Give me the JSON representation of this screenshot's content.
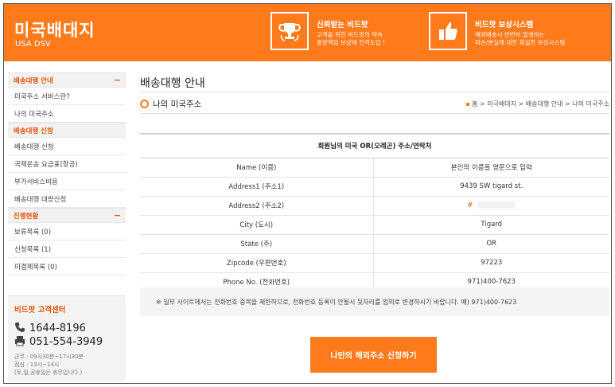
{
  "header": {
    "logo_title": "미국배대지",
    "logo_sub": "USA DSV",
    "promos": [
      {
        "icon": "trophy-icon",
        "title": "신뢰받는 비드팟",
        "lines": [
          "고객을 위한 비드팟의 약속",
          "중량책임 보상제 전격도입 !"
        ]
      },
      {
        "icon": "thumbs-up-icon",
        "title": "비드팟 보상시스템",
        "lines": [
          "해외배송시 빈번히 발생하는",
          "파손/분실에 대한 확실한 보상시스템"
        ]
      }
    ]
  },
  "sidebar": {
    "sections": [
      {
        "title": "배송대행 안내",
        "toggle": "−",
        "items": [
          "미국주소 서비스란?",
          "나의 미국주소"
        ]
      },
      {
        "title": "배송대행 신청",
        "toggle": "",
        "items": [
          "배송대행 신청",
          "국제운송 요금표(항공)",
          "부가서비스비용",
          "배송대행 대량신청"
        ]
      },
      {
        "title": "진행현황",
        "toggle": "−",
        "items": [
          "보류목록 (0)",
          "신청목록 (1)",
          "미결제목록 (0)"
        ]
      }
    ],
    "customer_center": {
      "title": "비드팟 고객센터",
      "phone": "1644-8196",
      "fax": "051-554-3949",
      "hours": [
        "근무 : 09시30분~17시30분",
        "점심 : 13시~14시",
        "(토,일,공휴일은 휴무입니다.)"
      ]
    }
  },
  "main": {
    "page_title": "배송대행 안내",
    "sub_title": "나의 미국주소",
    "breadcrumb": "홈 > 미국배대지 > 배송대행 안내 > 나의 미국주소",
    "table": {
      "header": "회원님의 미국 OR(오레곤) 주소/연락처",
      "rows": [
        {
          "label": "Name (이름)",
          "value": "본인의 이름을 영문으로 입력"
        },
        {
          "label": "Address1 (주소1)",
          "value": "9439 SW tigard st."
        },
        {
          "label": "Address2 (주소2)",
          "value": "#"
        },
        {
          "label": "City (도시)",
          "value": "Tigard"
        },
        {
          "label": "State (주)",
          "value": "OR"
        },
        {
          "label": "Zipcode (우편번호)",
          "value": "97223"
        },
        {
          "label": "Phone No. (전화번호)",
          "value": "971)400-7623"
        }
      ]
    },
    "notice": "※ 일부 사이트에서는 전화번호 중복을 제한하므로, 전화번호 등록이 안될시 뒷자리를 임의로 변경하시기 바랍니다. 예) 971)400-7623",
    "apply_button": "나만의 해외주소 신청하기"
  },
  "colors": {
    "accent": "#ff7a1a",
    "accent_text": "#e8550f"
  }
}
